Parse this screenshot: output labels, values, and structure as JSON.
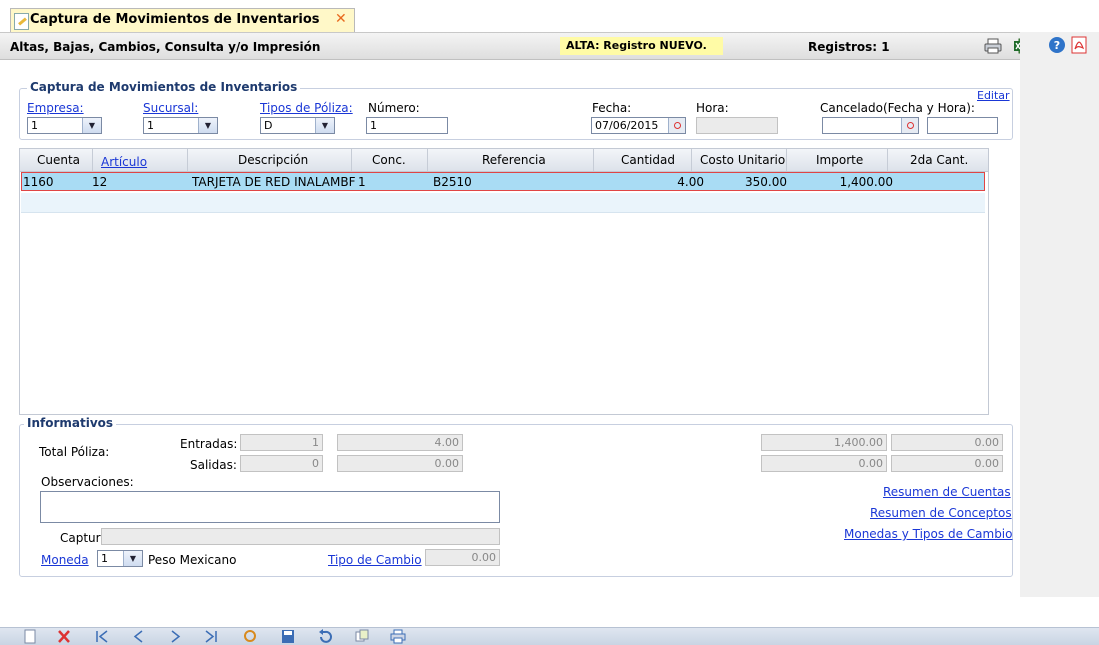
{
  "tab": {
    "title": "Captura de Movimientos de Inventarios",
    "close": "✕"
  },
  "header": {
    "subtitle": "Altas, Bajas, Cambios, Consulta y/o Impresión",
    "status": "ALTA: Registro NUEVO.",
    "records": "Registros: 1",
    "icons": [
      "print-icon",
      "excel-icon",
      "help-icon",
      "pdf-icon"
    ]
  },
  "capture": {
    "legend": "Captura de Movimientos de Inventarios",
    "empresa_label": "Empresa:",
    "empresa_value": "1",
    "sucursal_label": "Sucursal:",
    "sucursal_value": "1",
    "tipos_label": "Tipos de Póliza:",
    "tipos_value": "D",
    "numero_label": "Número:",
    "numero_value": "1",
    "fecha_label": "Fecha:",
    "fecha_value": "07/06/2015",
    "hora_label": "Hora:",
    "hora_value": "",
    "cancelado_label": "Cancelado(Fecha y Hora):",
    "cancelado_date": "",
    "cancelado_time": "",
    "editar": "Editar"
  },
  "grid": {
    "columns": [
      "Cuenta",
      "Artículo",
      "Descripción",
      "Conc.",
      "Referencia",
      "Cantidad",
      "Costo Unitario",
      "Importe",
      "2da Cant."
    ],
    "rows": [
      {
        "cuenta": "1160",
        "articulo": "12",
        "descripcion": "TARJETA DE RED INALAMBF",
        "conc": "1",
        "referencia": "B2510",
        "cantidad": "4.00",
        "costo": "350.00",
        "importe": "1,400.00",
        "segunda": ""
      }
    ]
  },
  "info": {
    "legend": "Informativos",
    "total_poliza": "Total Póliza:",
    "entradas_label": "Entradas:",
    "entradas_count": "1",
    "entradas_qty": "4.00",
    "salidas_label": "Salidas:",
    "salidas_count": "0",
    "salidas_qty": "0.00",
    "entradas_importe": "1,400.00",
    "entradas_extra": "0.00",
    "salidas_importe": "0.00",
    "salidas_extra": "0.00",
    "observaciones_label": "Observaciones:",
    "observaciones_value": "",
    "capturo_label": "Capturó:",
    "capturo_value": "",
    "moneda_label": "Moneda",
    "moneda_value": "1",
    "moneda_name": "Peso Mexicano",
    "tipo_cambio_label": "Tipo de Cambio",
    "tipo_cambio_value": "0.00",
    "resumen_cuentas": "Resumen de Cuentas",
    "resumen_conceptos": "Resumen de Conceptos",
    "monedas_tipos": "Monedas y Tipos de Cambio"
  },
  "toolbar": {
    "icons": [
      "new-icon",
      "delete-icon",
      "first-icon",
      "previous-icon",
      "next-icon",
      "last-icon",
      "search-icon",
      "save-icon",
      "undo-icon",
      "copy-icon",
      "print-icon"
    ]
  }
}
